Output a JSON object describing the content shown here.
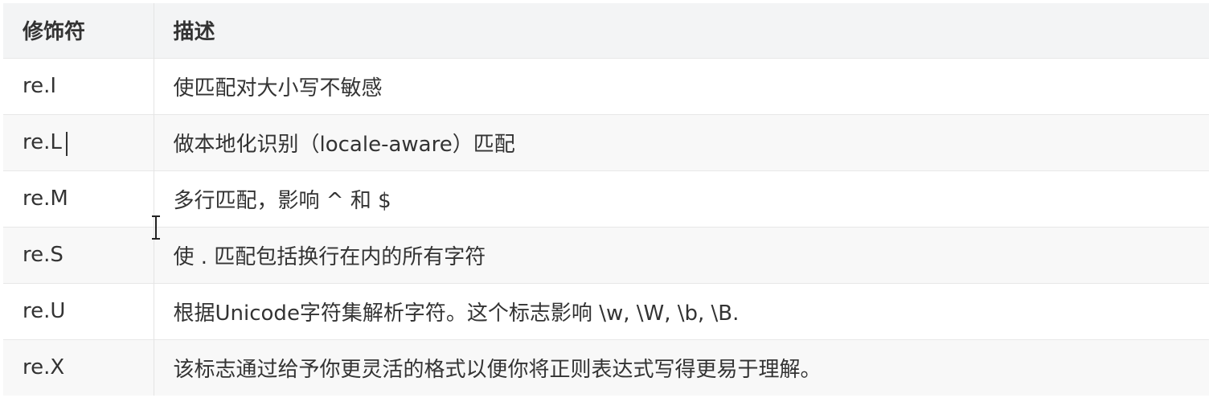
{
  "table": {
    "headers": [
      "修饰符",
      "描述"
    ],
    "rows": [
      {
        "modifier": "re.I",
        "description": "使匹配对大小写不敏感"
      },
      {
        "modifier": "re.L",
        "description": "做本地化识别（locale-aware）匹配"
      },
      {
        "modifier": "re.M",
        "description": "多行匹配，影响 ^ 和 $"
      },
      {
        "modifier": "re.S",
        "description": "使 . 匹配包括换行在内的所有字符"
      },
      {
        "modifier": "re.U",
        "description": "根据Unicode字符集解析字符。这个标志影响 \\w, \\W, \\b, \\B."
      },
      {
        "modifier": "re.X",
        "description": "该标志通过给予你更灵活的格式以便你将正则表达式写得更易于理解。"
      }
    ]
  },
  "cursor_icon": "text-cursor-icon"
}
